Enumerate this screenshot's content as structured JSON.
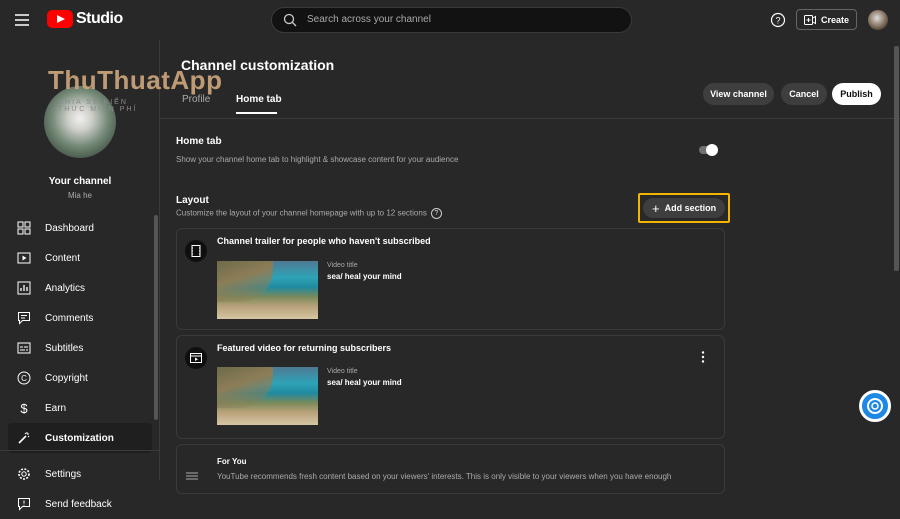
{
  "topbar": {
    "studio_label": "Studio",
    "search_placeholder": "Search across your channel",
    "create_label": "Create"
  },
  "watermark": {
    "title": "ThuThuatApp",
    "subtitle": "CHIA SẺ KIẾN THỨC MIỄN PHÍ"
  },
  "channel": {
    "label": "Your channel",
    "handle": "Mia he"
  },
  "sidebar": {
    "items": [
      {
        "label": "Dashboard",
        "icon": "dashboard-icon"
      },
      {
        "label": "Content",
        "icon": "content-icon"
      },
      {
        "label": "Analytics",
        "icon": "analytics-icon"
      },
      {
        "label": "Comments",
        "icon": "comments-icon"
      },
      {
        "label": "Subtitles",
        "icon": "subtitles-icon"
      },
      {
        "label": "Copyright",
        "icon": "copyright-icon"
      },
      {
        "label": "Earn",
        "icon": "dollar-icon"
      },
      {
        "label": "Customization",
        "icon": "magic-wand-icon"
      }
    ],
    "bottom": [
      {
        "label": "Settings",
        "icon": "gear-icon"
      },
      {
        "label": "Send feedback",
        "icon": "feedback-icon"
      }
    ]
  },
  "main": {
    "title": "Channel customization",
    "tabs": [
      "Profile",
      "Home tab"
    ],
    "buttons": {
      "view": "View channel",
      "cancel": "Cancel",
      "publish": "Publish"
    },
    "home_tab": {
      "title": "Home tab",
      "desc": "Show your channel home tab to highlight & showcase content for your audience",
      "enabled": true
    },
    "layout": {
      "title": "Layout",
      "desc": "Customize the layout of your channel homepage with up to 12 sections",
      "add_label": "Add section"
    },
    "cards": [
      {
        "title": "Channel trailer for people who haven't subscribed",
        "video_label": "Video title",
        "video_value": "sea/ heal your mind"
      },
      {
        "title": "Featured video for returning subscribers",
        "video_label": "Video title",
        "video_value": "sea/ heal your mind"
      }
    ],
    "foryou": {
      "title": "For You",
      "desc": "YouTube recommends fresh content based on your viewers' interests. This is only visible to your viewers when you have enough"
    }
  },
  "colors": {
    "accent_highlight": "#f5b400",
    "brand_red": "#ff0000",
    "help_blue": "#1e88e5"
  }
}
